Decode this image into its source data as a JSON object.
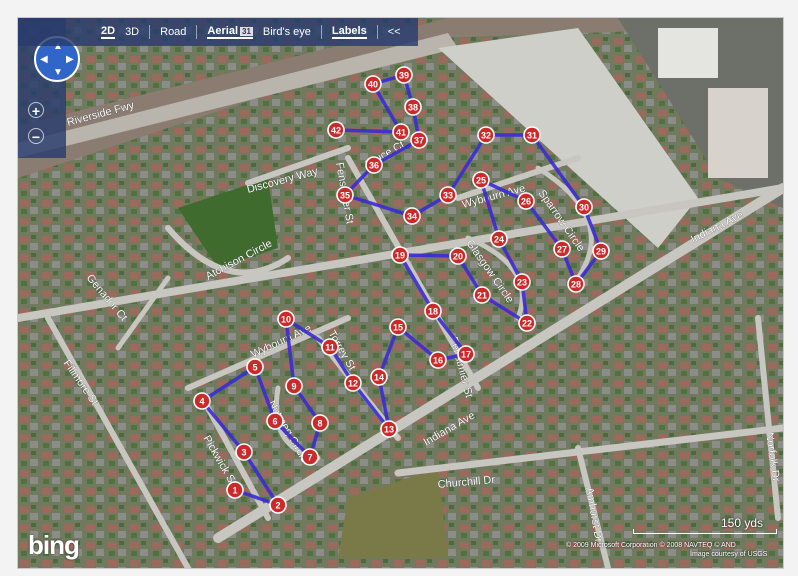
{
  "toolbar": {
    "view_2d": "2D",
    "view_3d": "3D",
    "road": "Road",
    "aerial": "Aerial",
    "aerial_badge": "31",
    "birds_eye": "Bird's eye",
    "labels": "Labels",
    "collapse": "<<"
  },
  "nav": {
    "zoom_in": "+",
    "zoom_out": "−"
  },
  "streets": [
    {
      "name": "Riverside Fwy"
    },
    {
      "name": "Discovery Way"
    },
    {
      "name": "Atchison Circle"
    },
    {
      "name": "Genador Ct"
    },
    {
      "name": "Fillmore St"
    },
    {
      "name": "Wybourn Ave"
    },
    {
      "name": "Torrey St"
    },
    {
      "name": "Nutmeg Circle"
    },
    {
      "name": "Pickwick St"
    },
    {
      "name": "Fenstmier St"
    },
    {
      "name": "Fenstmier St"
    },
    {
      "name": "Bruce Ct"
    },
    {
      "name": "Wybourn Ave"
    },
    {
      "name": "Glasgow Circle"
    },
    {
      "name": "Sparrow Circle"
    },
    {
      "name": "Indiana Ave"
    },
    {
      "name": "Indiana Ave"
    },
    {
      "name": "Churchill Dr"
    },
    {
      "name": "Amhurst Dr"
    },
    {
      "name": "Norfolk Dr"
    }
  ],
  "route": {
    "color": "#3a2bd6",
    "stops": [
      {
        "n": "1"
      },
      {
        "n": "2"
      },
      {
        "n": "3"
      },
      {
        "n": "4"
      },
      {
        "n": "5"
      },
      {
        "n": "6"
      },
      {
        "n": "7"
      },
      {
        "n": "8"
      },
      {
        "n": "9"
      },
      {
        "n": "10"
      },
      {
        "n": "11"
      },
      {
        "n": "12"
      },
      {
        "n": "13"
      },
      {
        "n": "14"
      },
      {
        "n": "15"
      },
      {
        "n": "16"
      },
      {
        "n": "17"
      },
      {
        "n": "18"
      },
      {
        "n": "19"
      },
      {
        "n": "20"
      },
      {
        "n": "21"
      },
      {
        "n": "22"
      },
      {
        "n": "23"
      },
      {
        "n": "24"
      },
      {
        "n": "25"
      },
      {
        "n": "26"
      },
      {
        "n": "27"
      },
      {
        "n": "28"
      },
      {
        "n": "29"
      },
      {
        "n": "30"
      },
      {
        "n": "31"
      },
      {
        "n": "32"
      },
      {
        "n": "33"
      },
      {
        "n": "34"
      },
      {
        "n": "35"
      },
      {
        "n": "36"
      },
      {
        "n": "37"
      },
      {
        "n": "38"
      },
      {
        "n": "39"
      },
      {
        "n": "40"
      },
      {
        "n": "41"
      },
      {
        "n": "42"
      }
    ]
  },
  "scale": {
    "label": "150 yds"
  },
  "brand": {
    "logo": "bing"
  },
  "copyright": {
    "line1": "© 2009 Microsoft Corporation   © 2008 NAVTEQ   © AND",
    "line2": "Image courtesy of USGS"
  }
}
